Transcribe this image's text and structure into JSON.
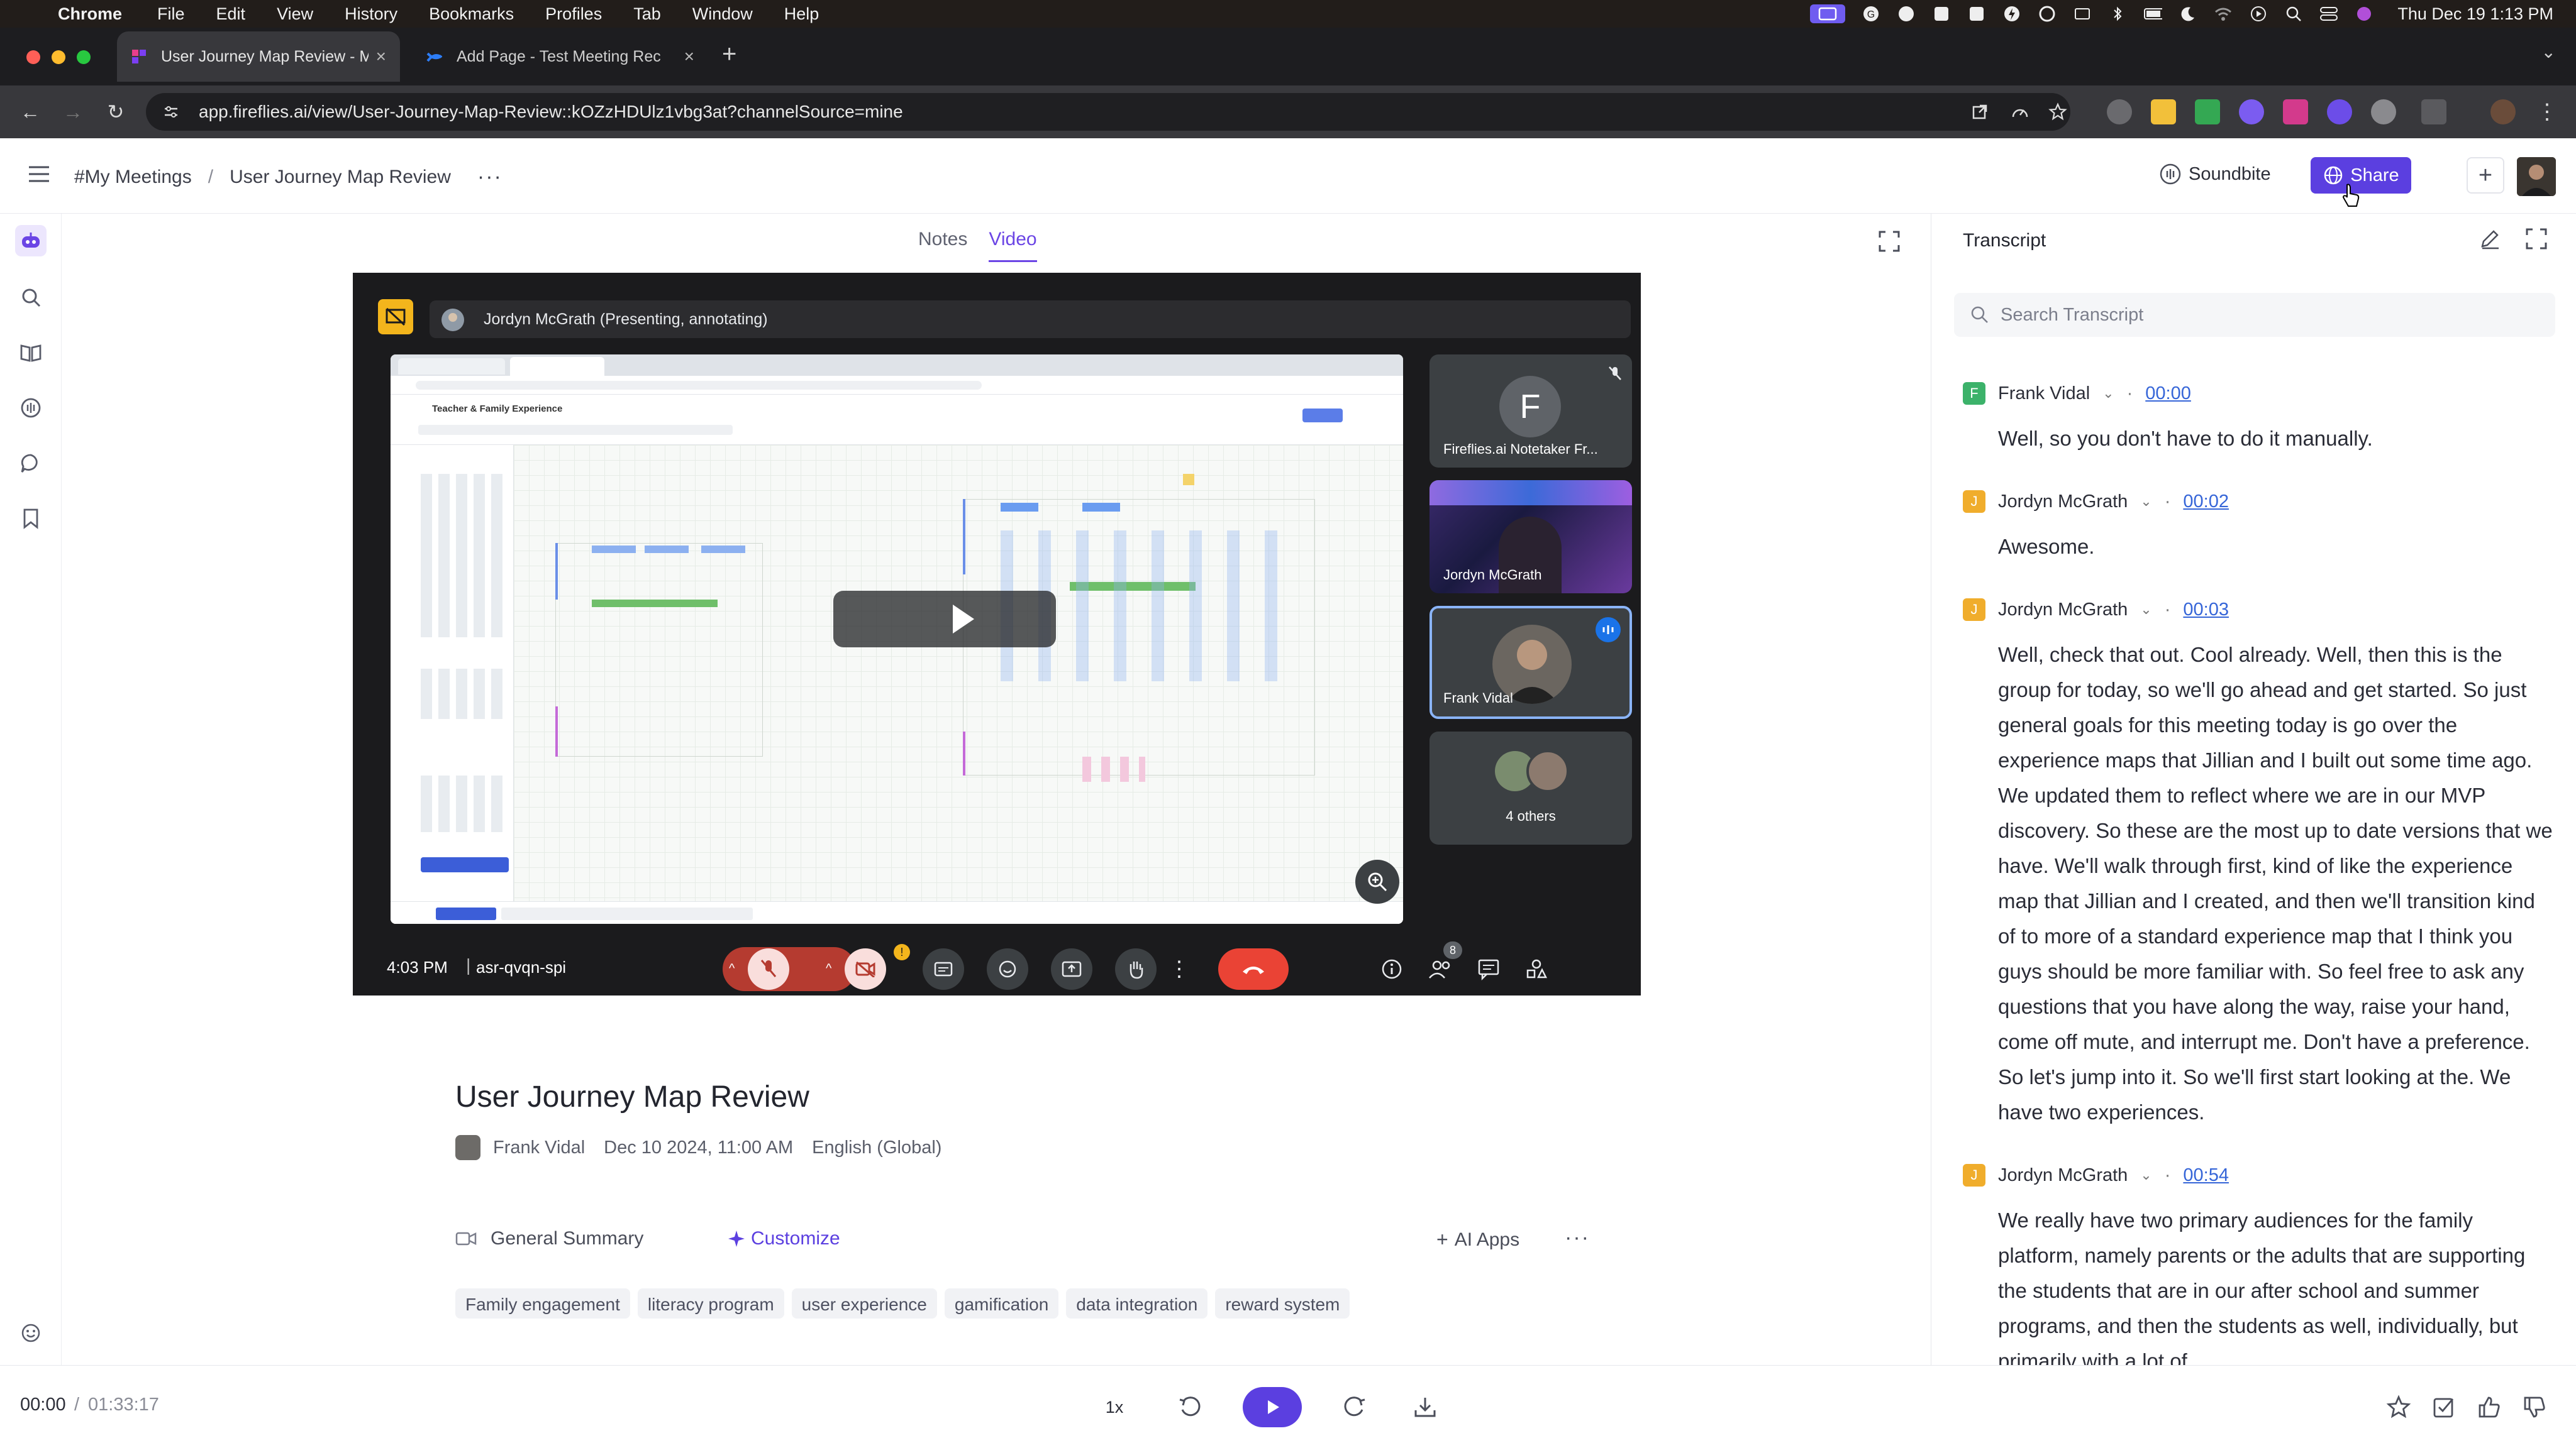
{
  "mac_menu": {
    "app": "Chrome",
    "items": [
      "File",
      "Edit",
      "View",
      "History",
      "Bookmarks",
      "Profiles",
      "Tab",
      "Window",
      "Help"
    ],
    "clock": "Thu Dec 19  1:13 PM"
  },
  "browser": {
    "tabs": [
      {
        "title": "User Journey Map Review - M"
      },
      {
        "title": "Add Page - Test Meeting Rec"
      }
    ],
    "url": "app.fireflies.ai/view/User-Journey-Map-Review::kOZzHDUlz1vbg3at?channelSource=mine"
  },
  "header": {
    "breadcrumb": [
      "#My Meetings",
      "User Journey Map Review"
    ],
    "soundbite_label": "Soundbite",
    "share_label": "Share"
  },
  "view_tabs": [
    "Notes",
    "Video"
  ],
  "video": {
    "presenter": "Jordyn McGrath (Presenting, annotating)",
    "shared_doc_title": "Teacher & Family Experience",
    "participants": [
      {
        "initial": "F",
        "name": "Fireflies.ai Notetaker Fr..."
      },
      {
        "name": "Jordyn McGrath"
      },
      {
        "name": "Frank Vidal"
      },
      {
        "name": "4 others"
      }
    ],
    "time": "4:03 PM",
    "meeting_code": "asr-qvqn-spi",
    "people_count": "8"
  },
  "meeting": {
    "title": "User Journey Map Review",
    "host": "Frank Vidal",
    "date": "Dec 10 2024, 11:00 AM",
    "language": "English (Global)",
    "summary_label": "General Summary",
    "customize_label": "Customize",
    "ai_apps_label": "AI Apps",
    "topics": [
      "Family engagement",
      "literacy program",
      "user experience",
      "gamification",
      "data integration",
      "reward system"
    ]
  },
  "transcript": {
    "title": "Transcript",
    "search_placeholder": "Search Transcript",
    "segments": [
      {
        "initial": "F",
        "speaker": "Frank Vidal",
        "time": "00:00",
        "text": "Well, so you don't have to do it manually."
      },
      {
        "initial": "J",
        "speaker": "Jordyn McGrath",
        "time": "00:02",
        "text": "Awesome."
      },
      {
        "initial": "J",
        "speaker": "Jordyn McGrath",
        "time": "00:03",
        "text": "Well, check that out. Cool already. Well, then this is the group for today, so we'll go ahead and get started. So just general goals for this meeting today is go over the experience maps that Jillian and I built out some time ago. We updated them to reflect where we are in our MVP discovery. So these are the most up to date versions that we have. We'll walk through first, kind of like the experience map that Jillian and I created, and then we'll transition kind of to more of a standard experience map that I think you guys should be more familiar with. So feel free to ask any questions that you have along the way, raise your hand, come off mute, and interrupt me. Don't have a preference. So let's jump into it. So we'll first start looking at the. We have two experiences."
      },
      {
        "initial": "J",
        "speaker": "Jordyn McGrath",
        "time": "00:54",
        "text": "We really have two primary audiences for the family platform, namely parents or the adults that are supporting the students that are in our after school and summer programs, and then the students as well, individually, but primarily with a lot of"
      }
    ]
  },
  "player": {
    "current": "00:00",
    "total": "01:33:17",
    "speed": "1x"
  },
  "colors": {
    "accent": "#5b3fe0",
    "link": "#3565d8",
    "end_call": "#ea4335"
  }
}
